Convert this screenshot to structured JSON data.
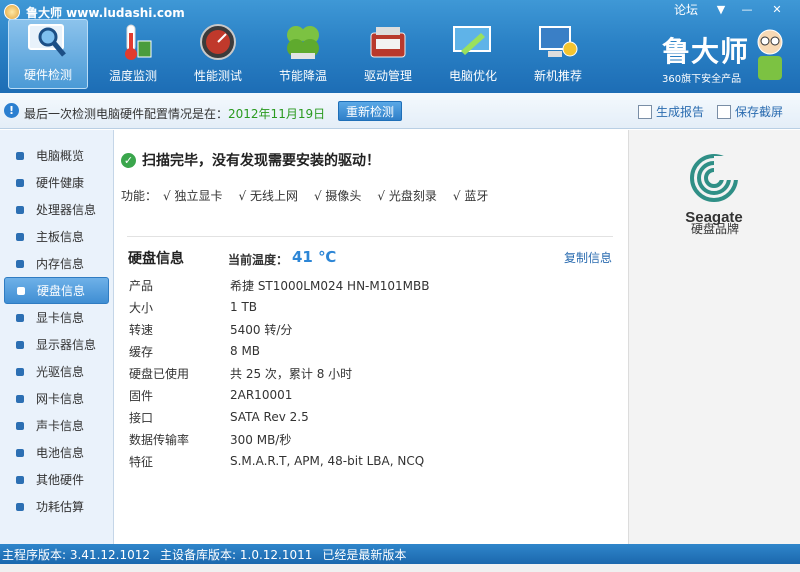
{
  "app": {
    "title": "鲁大师 www.ludashi.com"
  },
  "window": {
    "forum": "论坛",
    "menu_icon": "dropdown-arrow-icon",
    "minimize_icon": "minimize-icon",
    "close_icon": "close-icon"
  },
  "toolbar": {
    "items": [
      {
        "label": "硬件检测",
        "icon": "monitor-magnifier-icon",
        "active": true
      },
      {
        "label": "温度监测",
        "icon": "thermometer-icon",
        "active": false
      },
      {
        "label": "性能测试",
        "icon": "speedometer-icon",
        "active": false
      },
      {
        "label": "节能降温",
        "icon": "clover-icon",
        "active": false
      },
      {
        "label": "驱动管理",
        "icon": "toolbox-icon",
        "active": false
      },
      {
        "label": "电脑优化",
        "icon": "broom-screen-icon",
        "active": false
      },
      {
        "label": "新机推荐",
        "icon": "computer-award-icon",
        "active": false
      }
    ],
    "brand_name": "鲁大师",
    "brand_sub": "360旗下安全产品"
  },
  "infobar": {
    "message": "最后一次检测电脑硬件配置情况是在：",
    "date": "2012年11月19日",
    "redetect": "重新检测",
    "report": "生成报告",
    "save_screenshot": "保存截屏"
  },
  "sidebar": {
    "items": [
      {
        "label": "电脑概览",
        "active": false
      },
      {
        "label": "硬件健康",
        "active": false
      },
      {
        "label": "处理器信息",
        "active": false
      },
      {
        "label": "主板信息",
        "active": false
      },
      {
        "label": "内存信息",
        "active": false
      },
      {
        "label": "硬盘信息",
        "active": true
      },
      {
        "label": "显卡信息",
        "active": false
      },
      {
        "label": "显示器信息",
        "active": false
      },
      {
        "label": "光驱信息",
        "active": false
      },
      {
        "label": "网卡信息",
        "active": false
      },
      {
        "label": "声卡信息",
        "active": false
      },
      {
        "label": "电池信息",
        "active": false
      },
      {
        "label": "其他硬件",
        "active": false
      },
      {
        "label": "功耗估算",
        "active": false
      }
    ]
  },
  "main": {
    "scan_status": "扫描完毕，没有发现需要安装的驱动！",
    "features_label": "功能：",
    "features": [
      "√ 独立显卡",
      "√ 无线上网",
      "√ 摄像头",
      "√ 光盘刻录",
      "√ 蓝牙"
    ],
    "disk_title": "硬盘信息",
    "temp_label": "当前温度：",
    "temp_value": "41 ℃",
    "copy_info": "复制信息",
    "properties": [
      {
        "key": "产品",
        "value": "希捷 ST1000LM024 HN-M101MBB"
      },
      {
        "key": "大小",
        "value": "1 TB"
      },
      {
        "key": "转速",
        "value": "5400 转/分"
      },
      {
        "key": "缓存",
        "value": "8 MB"
      },
      {
        "key": "硬盘已使用",
        "value": "共 25 次，累计 8 小时"
      },
      {
        "key": "固件",
        "value": "2AR10001"
      },
      {
        "key": "接口",
        "value": "SATA Rev 2.5"
      },
      {
        "key": "数据传输率",
        "value": "300 MB/秒"
      },
      {
        "key": "特征",
        "value": "S.M.A.R.T,  APM,  48-bit LBA,  NCQ"
      }
    ]
  },
  "brand_panel": {
    "logo_text": "Seagate",
    "caption": "硬盘品牌"
  },
  "footer": {
    "main_version": "主程序版本: 3.41.12.1012",
    "db_version": "主设备库版本: 1.0.12.1011",
    "status": "已经是最新版本"
  },
  "colors": {
    "accent": "#2b82c6",
    "date_green": "#2a9a1f",
    "temp_blue": "#2d86d6",
    "link": "#2b6cb0"
  }
}
